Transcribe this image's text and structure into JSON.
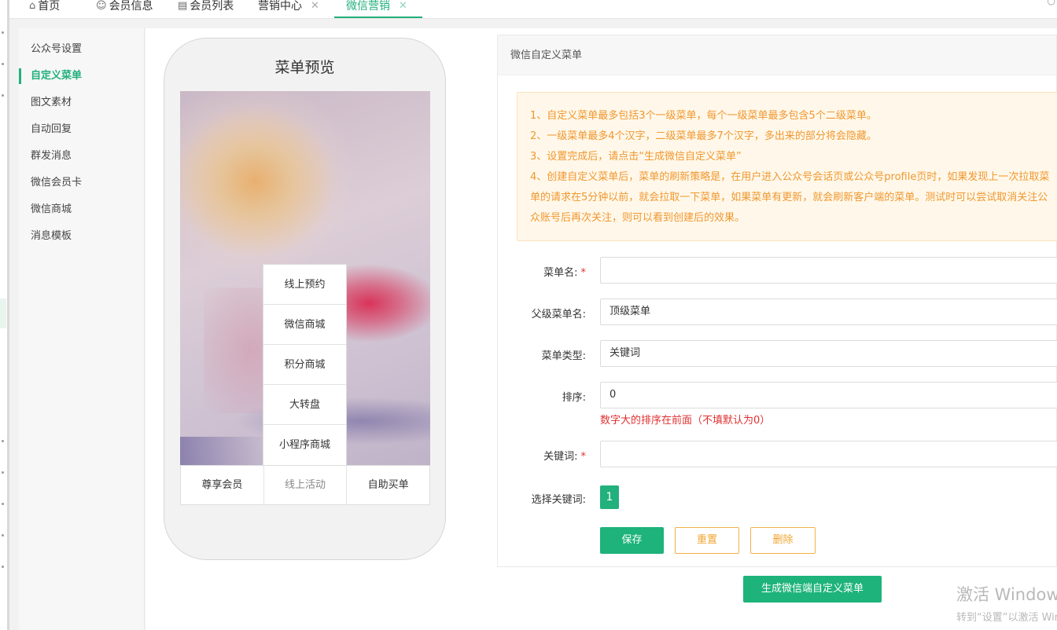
{
  "tabs": [
    {
      "label": "首页",
      "icon": "home-icon"
    },
    {
      "label": "会员信息",
      "icon": "user-icon"
    },
    {
      "label": "会员列表",
      "icon": "document-icon"
    },
    {
      "label": "营销中心",
      "closable": true
    },
    {
      "label": "微信营销",
      "closable": true,
      "active": true
    }
  ],
  "sidebar": {
    "items": [
      {
        "label": "公众号设置"
      },
      {
        "label": "自定义菜单",
        "active": true
      },
      {
        "label": "图文素材"
      },
      {
        "label": "自动回复"
      },
      {
        "label": "群发消息"
      },
      {
        "label": "微信会员卡"
      },
      {
        "label": "微信商城"
      },
      {
        "label": "消息模板"
      }
    ]
  },
  "preview": {
    "title": "菜单预览",
    "submenu": [
      "线上预约",
      "微信商城",
      "积分商城",
      "大转盘",
      "小程序商城"
    ],
    "menubar": [
      "尊享会员",
      "线上活动",
      "自助买单"
    ]
  },
  "panel": {
    "title": "微信自定义菜单",
    "notice": [
      "1、自定义菜单最多包括3个一级菜单，每个一级菜单最多包含5个二级菜单。",
      "2、一级菜单最多4个汉字，二级菜单最多7个汉字，多出来的部分将会隐藏。",
      "3、设置完成后，请点击“生成微信自定义菜单”",
      "4、创建自定义菜单后，菜单的刷新策略是，在用户进入公众号会话页或公众号profile页时，如果发现上一次拉取菜",
      "单的请求在5分钟以前，就会拉取一下菜单，如果菜单有更新，就会刷新客户端的菜单。测试时可以尝试取消关注公",
      "众账号后再次关注，则可以看到创建后的效果。"
    ],
    "form": {
      "menu_name_label": "菜单名:",
      "menu_name_value": "",
      "parent_label": "父级菜单名:",
      "parent_value": "顶级菜单",
      "type_label": "菜单类型:",
      "type_value": "关键词",
      "sort_label": "排序:",
      "sort_value": "0",
      "sort_hint": "数字大的排序在前面（不填默认为0）",
      "keyword_label": "关键词:",
      "keyword_value": "",
      "choose_label": "选择关键词:",
      "choose_value": "1",
      "required_mark": "*"
    },
    "buttons": {
      "save": "保存",
      "reset": "重置",
      "delete": "删除"
    }
  },
  "generate_button": "生成微信端自定义菜单",
  "watermark": {
    "line1": "激活 Windows",
    "line2": "转到“设置”以激活 Windows。"
  },
  "colors": {
    "accent": "#22b07d",
    "button_green": "#1db37a",
    "notice_text": "#f0972f",
    "notice_bg": "#fff8ea",
    "warn_text": "#e03131",
    "outline_orange": "#f0b24a"
  }
}
